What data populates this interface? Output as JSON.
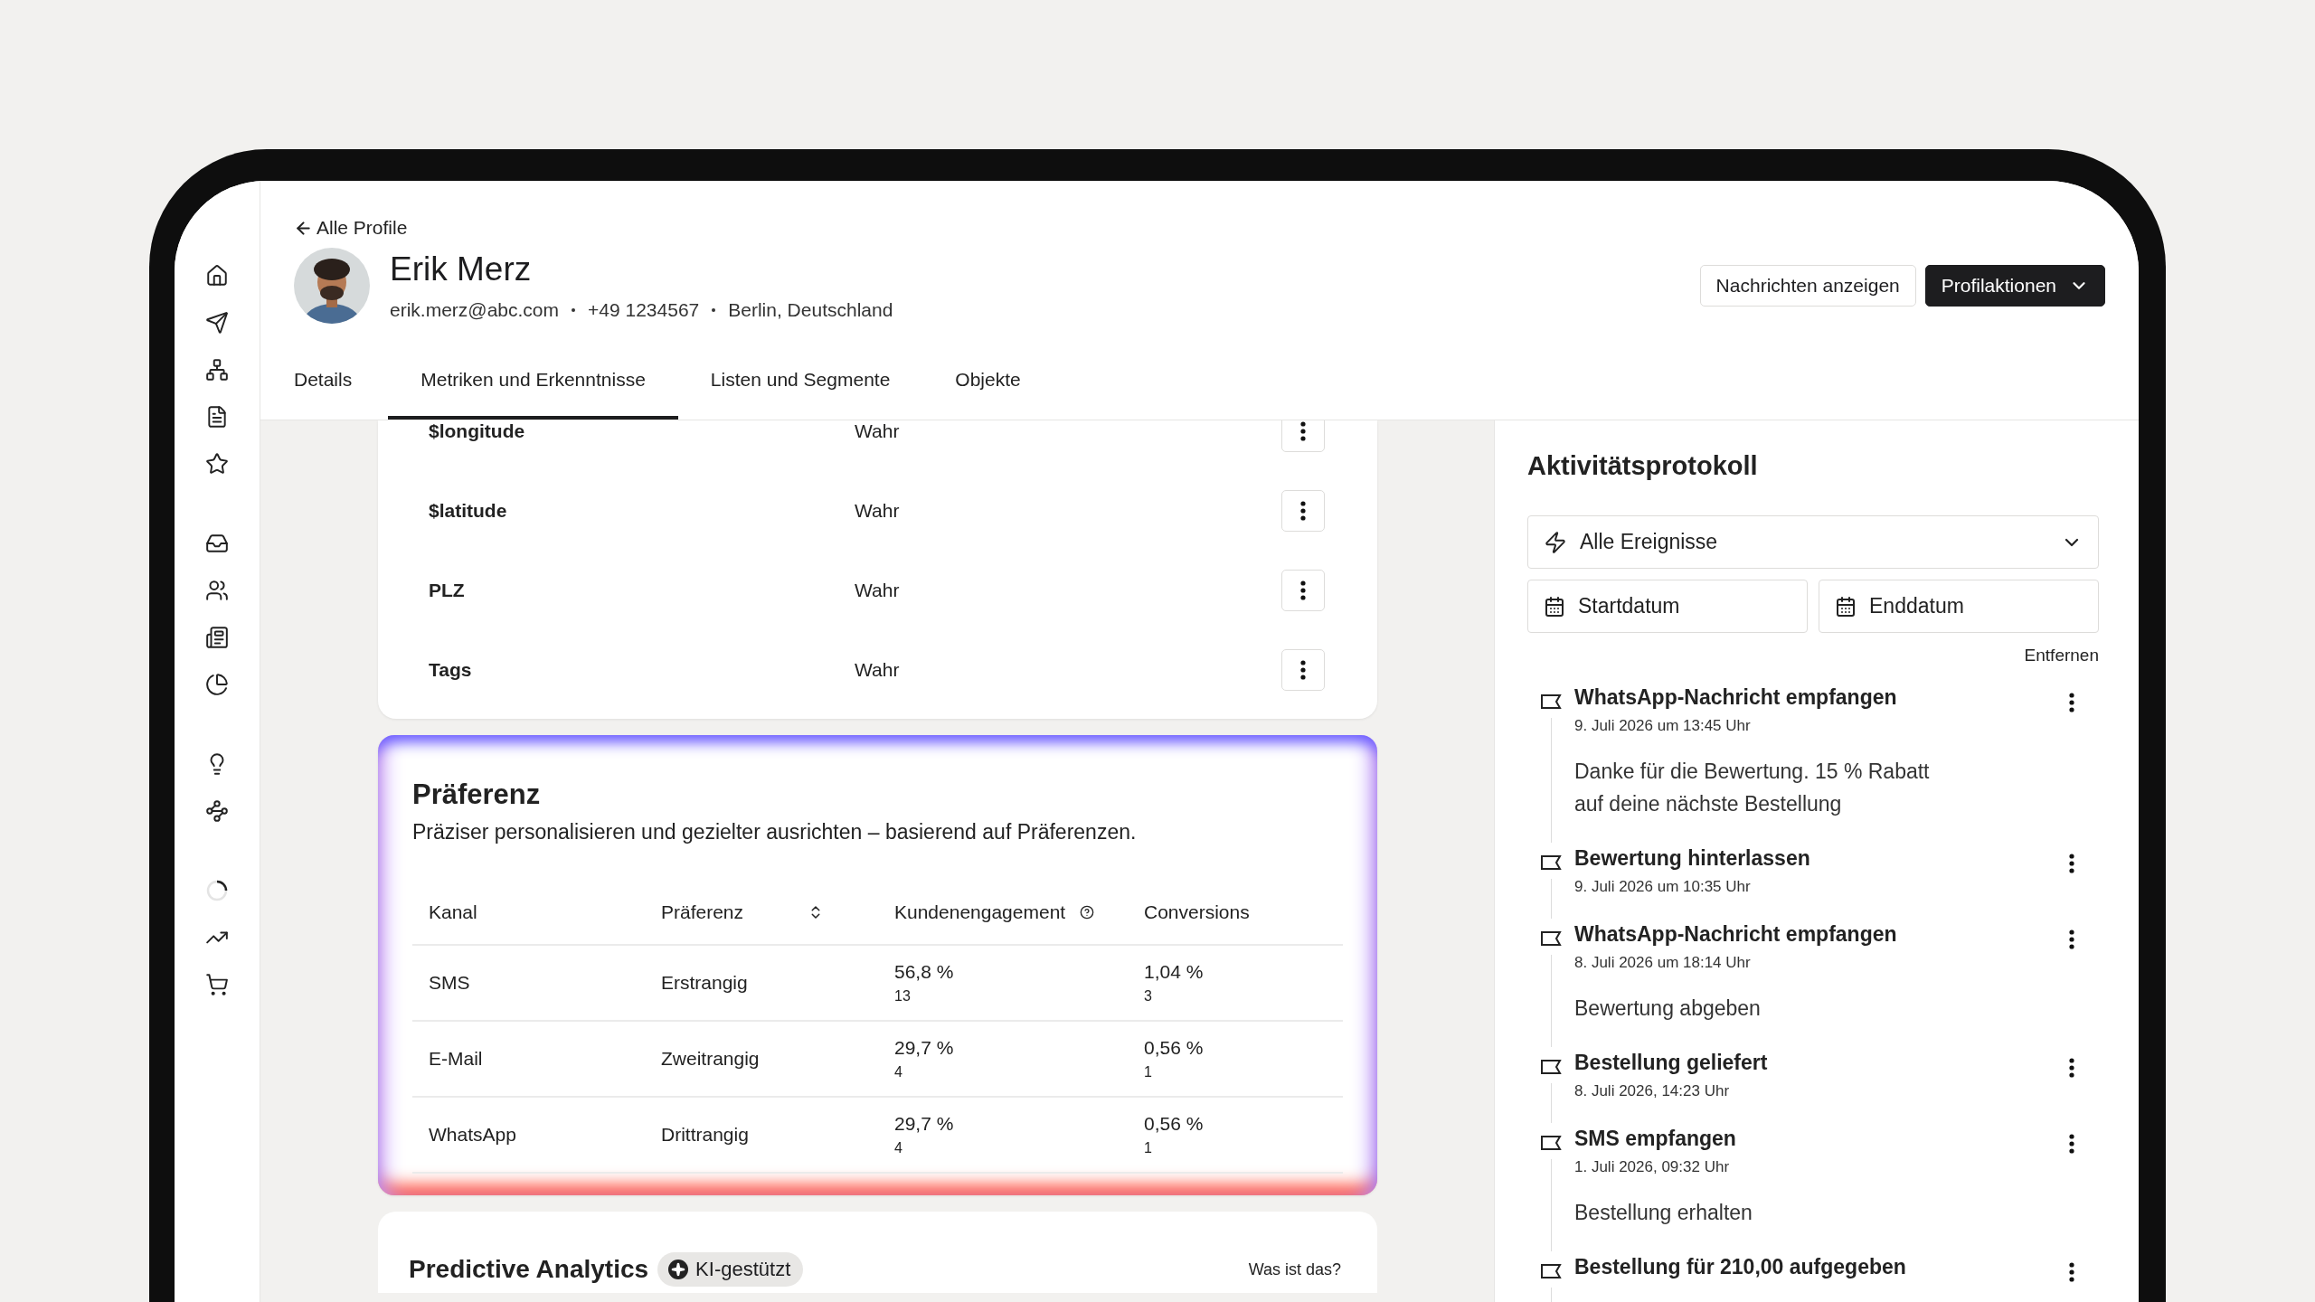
{
  "back_link": "Alle Profile",
  "profile": {
    "name": "Erik Merz",
    "email": "erik.merz@abc.com",
    "phone": "+49 1234567",
    "location": "Berlin, Deutschland"
  },
  "header_buttons": [
    {
      "label": "Nachrichten anzeigen",
      "kind": "secondary"
    },
    {
      "label": "Profilaktionen",
      "kind": "primary"
    }
  ],
  "tabs": [
    {
      "label": "Details",
      "selected": false
    },
    {
      "label": "Metriken und Erkenntnisse",
      "selected": true
    },
    {
      "label": "Listen und Segmente",
      "selected": false
    },
    {
      "label": "Objekte",
      "selected": false
    }
  ],
  "properties": [
    {
      "name": "$longitude",
      "value": "Wahr"
    },
    {
      "name": "$latitude",
      "value": "Wahr"
    },
    {
      "name": "PLZ",
      "value": "Wahr"
    },
    {
      "name": "Tags",
      "value": "Wahr"
    }
  ],
  "preference": {
    "title": "Präferenz",
    "description": "Präziser personalisieren und gezielter ausrichten – basierend auf Präferenzen.",
    "columns": [
      {
        "label": "Kanal",
        "kind": "plain"
      },
      {
        "label": "Präferenz",
        "kind": "sort"
      },
      {
        "label": "Kundenengagement",
        "kind": "help"
      },
      {
        "label": "Conversions",
        "kind": "plain"
      }
    ],
    "rows": [
      {
        "channel": "SMS",
        "preference": "Erstrangig",
        "engagement": "56,8 %",
        "engagement_count": "13",
        "conversions": "1,04 %",
        "conversions_count": "3"
      },
      {
        "channel": "E-Mail",
        "preference": "Zweitrangig",
        "engagement": "29,7 %",
        "engagement_count": "4",
        "conversions": "0,56 %",
        "conversions_count": "1"
      },
      {
        "channel": "WhatsApp",
        "preference": "Drittrangig",
        "engagement": "29,7 %",
        "engagement_count": "4",
        "conversions": "0,56 %",
        "conversions_count": "1"
      }
    ]
  },
  "predictive": {
    "title": "Predictive Analytics",
    "badge": "KI-gestützt",
    "link": "Was ist das?"
  },
  "activity": {
    "title": "Aktivitätsprotokoll",
    "filter": "Alle Ereignisse",
    "start_date": "Startdatum",
    "end_date": "Enddatum",
    "clear": "Entfernen",
    "events": [
      {
        "title": "WhatsApp-Nachricht empfangen",
        "time": "9. Juli 2026 um 13:45 Uhr",
        "message": "Danke für die Bewertung. 15 % Rabatt auf deine nächste Bestellung"
      },
      {
        "title": "Bewertung hinterlassen",
        "time": "9. Juli 2026 um 10:35 Uhr"
      },
      {
        "title": "WhatsApp-Nachricht empfangen",
        "time": "8. Juli 2026 um 18:14 Uhr",
        "message": "Bewertung abgeben"
      },
      {
        "title": "Bestellung geliefert",
        "time": "8. Juli 2026, 14:23 Uhr"
      },
      {
        "title": "SMS empfangen",
        "time": "1. Juli 2026, 09:32 Uhr",
        "message": "Bestellung erhalten"
      },
      {
        "title": "Bestellung für 210,00 aufgegeben"
      }
    ]
  }
}
